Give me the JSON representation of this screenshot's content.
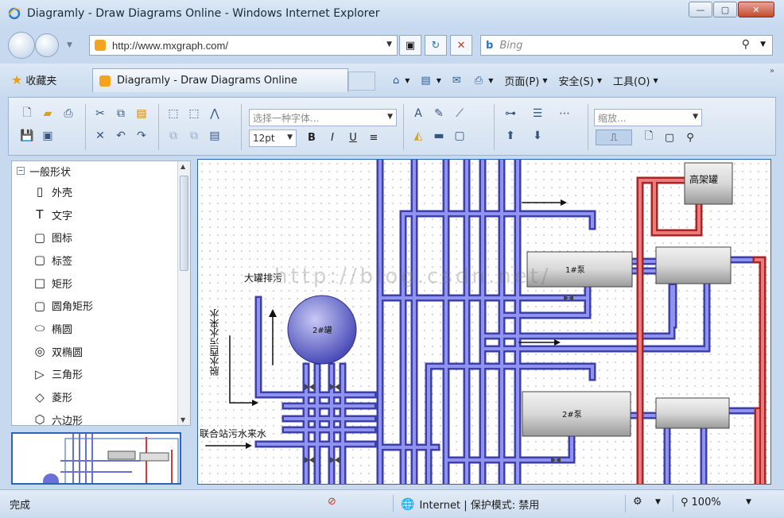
{
  "window": {
    "title": "Diagramly - Draw Diagrams Online - Windows Internet Explorer",
    "minimize": "—",
    "maximize": "▢",
    "close": "✕"
  },
  "address": {
    "url": "http://www.mxgraph.com/",
    "search_placeholder": "Bing"
  },
  "favorites": {
    "label": "收藏夹"
  },
  "tab": {
    "label": "Diagramly - Draw Diagrams Online"
  },
  "commands": [
    {
      "label": "页面(P)",
      "icon": "page-icon"
    },
    {
      "label": "安全(S)",
      "icon": "safety-icon"
    },
    {
      "label": "工具(O)",
      "icon": "tools-icon"
    }
  ],
  "toolbar": {
    "font_placeholder": "选择一种字体...",
    "font_size": "12pt",
    "bold": "B",
    "italic": "I",
    "underline": "U",
    "zoom_placeholder": "缩放..."
  },
  "shapes": {
    "header": "一般形状",
    "items": [
      {
        "glyph": "▯",
        "label": "外壳"
      },
      {
        "glyph": "T",
        "label": "文字"
      },
      {
        "glyph": "▢",
        "label": "图标"
      },
      {
        "glyph": "▢",
        "label": "标签"
      },
      {
        "glyph": "□",
        "label": "矩形"
      },
      {
        "glyph": "▢",
        "label": "圆角矩形"
      },
      {
        "glyph": "⬭",
        "label": "椭圆"
      },
      {
        "glyph": "◎",
        "label": "双椭圆"
      },
      {
        "glyph": "▷",
        "label": "三角形"
      },
      {
        "glyph": "◇",
        "label": "菱形"
      },
      {
        "glyph": "⬡",
        "label": "六边形"
      }
    ]
  },
  "diagram": {
    "high_tank": "高架罐",
    "pump1": "1#泵",
    "pump2": "2#泵",
    "tank2": "2#罐",
    "label_top_left": "大罐排污",
    "label_vertical": "脱水西污水来水",
    "label_bottom_left": "联合站污水来水",
    "watermark": "http://blog.csdn.net/"
  },
  "status": {
    "text": "完成",
    "zone": "Internet | 保护模式: 禁用",
    "zoom": "100%"
  },
  "colors": {
    "pipe_blue": "#5b5fd0",
    "pipe_red": "#d23b3b",
    "accent": "#2a66b8"
  }
}
